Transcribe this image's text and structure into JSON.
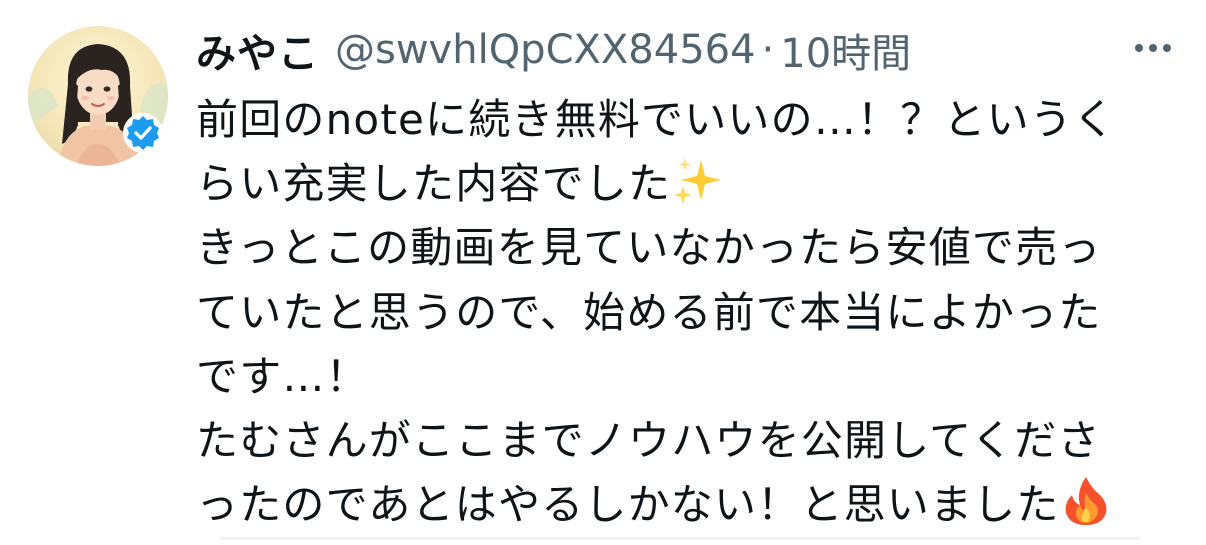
{
  "tweet": {
    "author": {
      "display_name": "みやこ",
      "handle": "@swvhlQpCXX84564",
      "verified": true
    },
    "separator": "·",
    "timestamp": "10時間",
    "text_lines": [
      "前回のnoteに続き無料でいいの…！？というく",
      "らい充実した内容でした",
      "きっとこの動画を見ていなかったら安値で売っ",
      "ていたと思うので、始める前で本当によかった",
      "です…！",
      "たむさんがここまでノウハウを公開してくださ",
      "ったのであとはやるしかない！と思いました"
    ],
    "emojis": {
      "sparkles": "sparkles-emoji",
      "fire": "fire-emoji"
    },
    "icons": {
      "more": "more-options-icon",
      "verified": "verified-badge-icon"
    },
    "colors": {
      "text": "#0f1419",
      "secondary": "#536471",
      "verified_blue": "#1d9bf0",
      "divider": "#eff3f4"
    }
  }
}
